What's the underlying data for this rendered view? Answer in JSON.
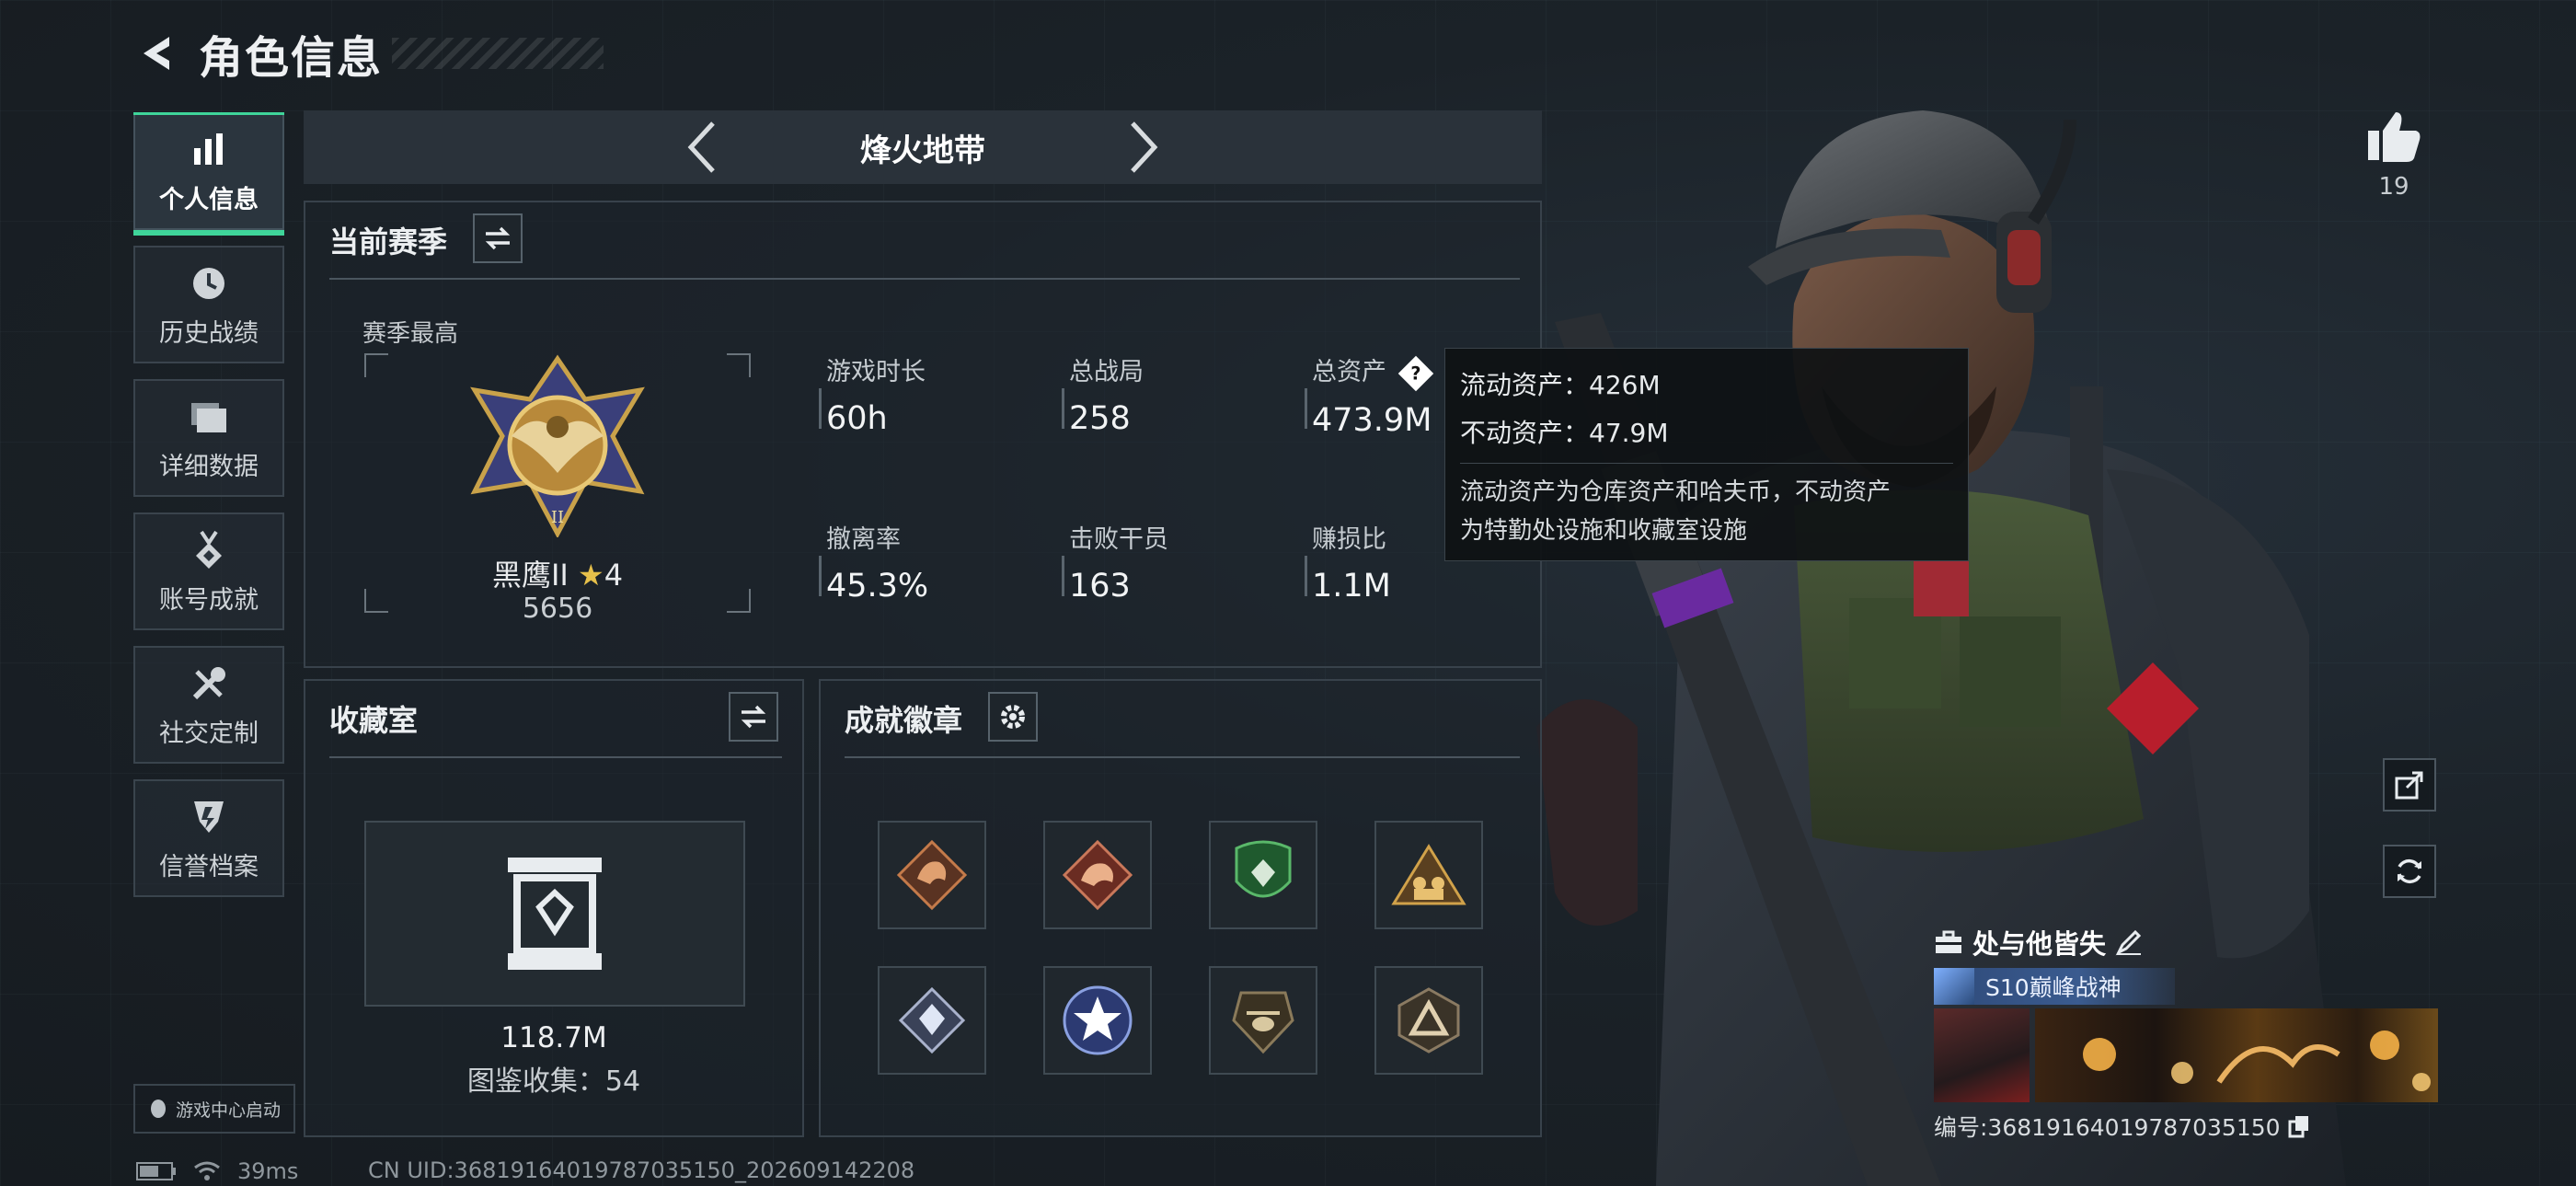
{
  "page": {
    "title": "角色信息"
  },
  "sidebar": {
    "items": [
      {
        "label": "个人信息",
        "icon": "bar-chart-icon",
        "active": true
      },
      {
        "label": "历史战绩",
        "icon": "clock-icon",
        "active": false
      },
      {
        "label": "详细数据",
        "icon": "folder-icon",
        "active": false
      },
      {
        "label": "账号成就",
        "icon": "medal-icon",
        "active": false
      },
      {
        "label": "社交定制",
        "icon": "tools-icon",
        "active": false
      },
      {
        "label": "信誉档案",
        "icon": "shield-icon",
        "active": false
      }
    ],
    "launch_label": "游戏中心启动"
  },
  "mode": {
    "title": "烽火地带"
  },
  "season": {
    "title": "当前赛季",
    "best_label": "赛季最高",
    "rank_name": "黑鹰II",
    "rank_stars": "4",
    "rank_score": "5656",
    "stats": [
      {
        "label": "游戏时长",
        "value": "60h"
      },
      {
        "label": "总战局",
        "value": "258"
      },
      {
        "label": "总资产",
        "value": "473.9M"
      },
      {
        "label": "撤离率",
        "value": "45.3%"
      },
      {
        "label": "击败干员",
        "value": "163"
      },
      {
        "label": "赚损比",
        "value": "1.1M"
      }
    ]
  },
  "tooltip": {
    "liquid": "流动资产：426M",
    "fixed": "不动资产：47.9M",
    "desc_1": "流动资产为仓库资产和哈夫币，不动资产",
    "desc_2": "为特勤处设施和收藏室设施"
  },
  "collection": {
    "title": "收藏室",
    "value": "118.7M",
    "count": "图鉴收集：54"
  },
  "achievements": {
    "title": "成就徽章",
    "badges": [
      {
        "icon": "dragon-badge-icon",
        "color": "#c47a4a"
      },
      {
        "icon": "dragon-badge-icon",
        "color": "#c9785a"
      },
      {
        "icon": "green-shield-badge-icon",
        "color": "#3a8a4a"
      },
      {
        "icon": "triangle-squad-badge-icon",
        "color": "#d1a24a"
      },
      {
        "icon": "crystal-badge-icon",
        "color": "#a9b2cc"
      },
      {
        "icon": "star-wreath-badge-icon",
        "color": "#5a6fb2"
      },
      {
        "icon": "helicopter-badge-icon",
        "color": "#8a7a5a"
      },
      {
        "icon": "triangle-badge-icon",
        "color": "#8a7a62"
      }
    ]
  },
  "social": {
    "likes": "19",
    "player_name": "处与他皆失",
    "title_badge": "S10巅峰战神",
    "player_id": "编号:3681916401978703515​0"
  },
  "status": {
    "ping": "39ms",
    "uid": "CN UID:3681916401978703515​0_202609142208"
  },
  "colors": {
    "accent": "#3fd59a",
    "panel_border": "#38424b"
  }
}
